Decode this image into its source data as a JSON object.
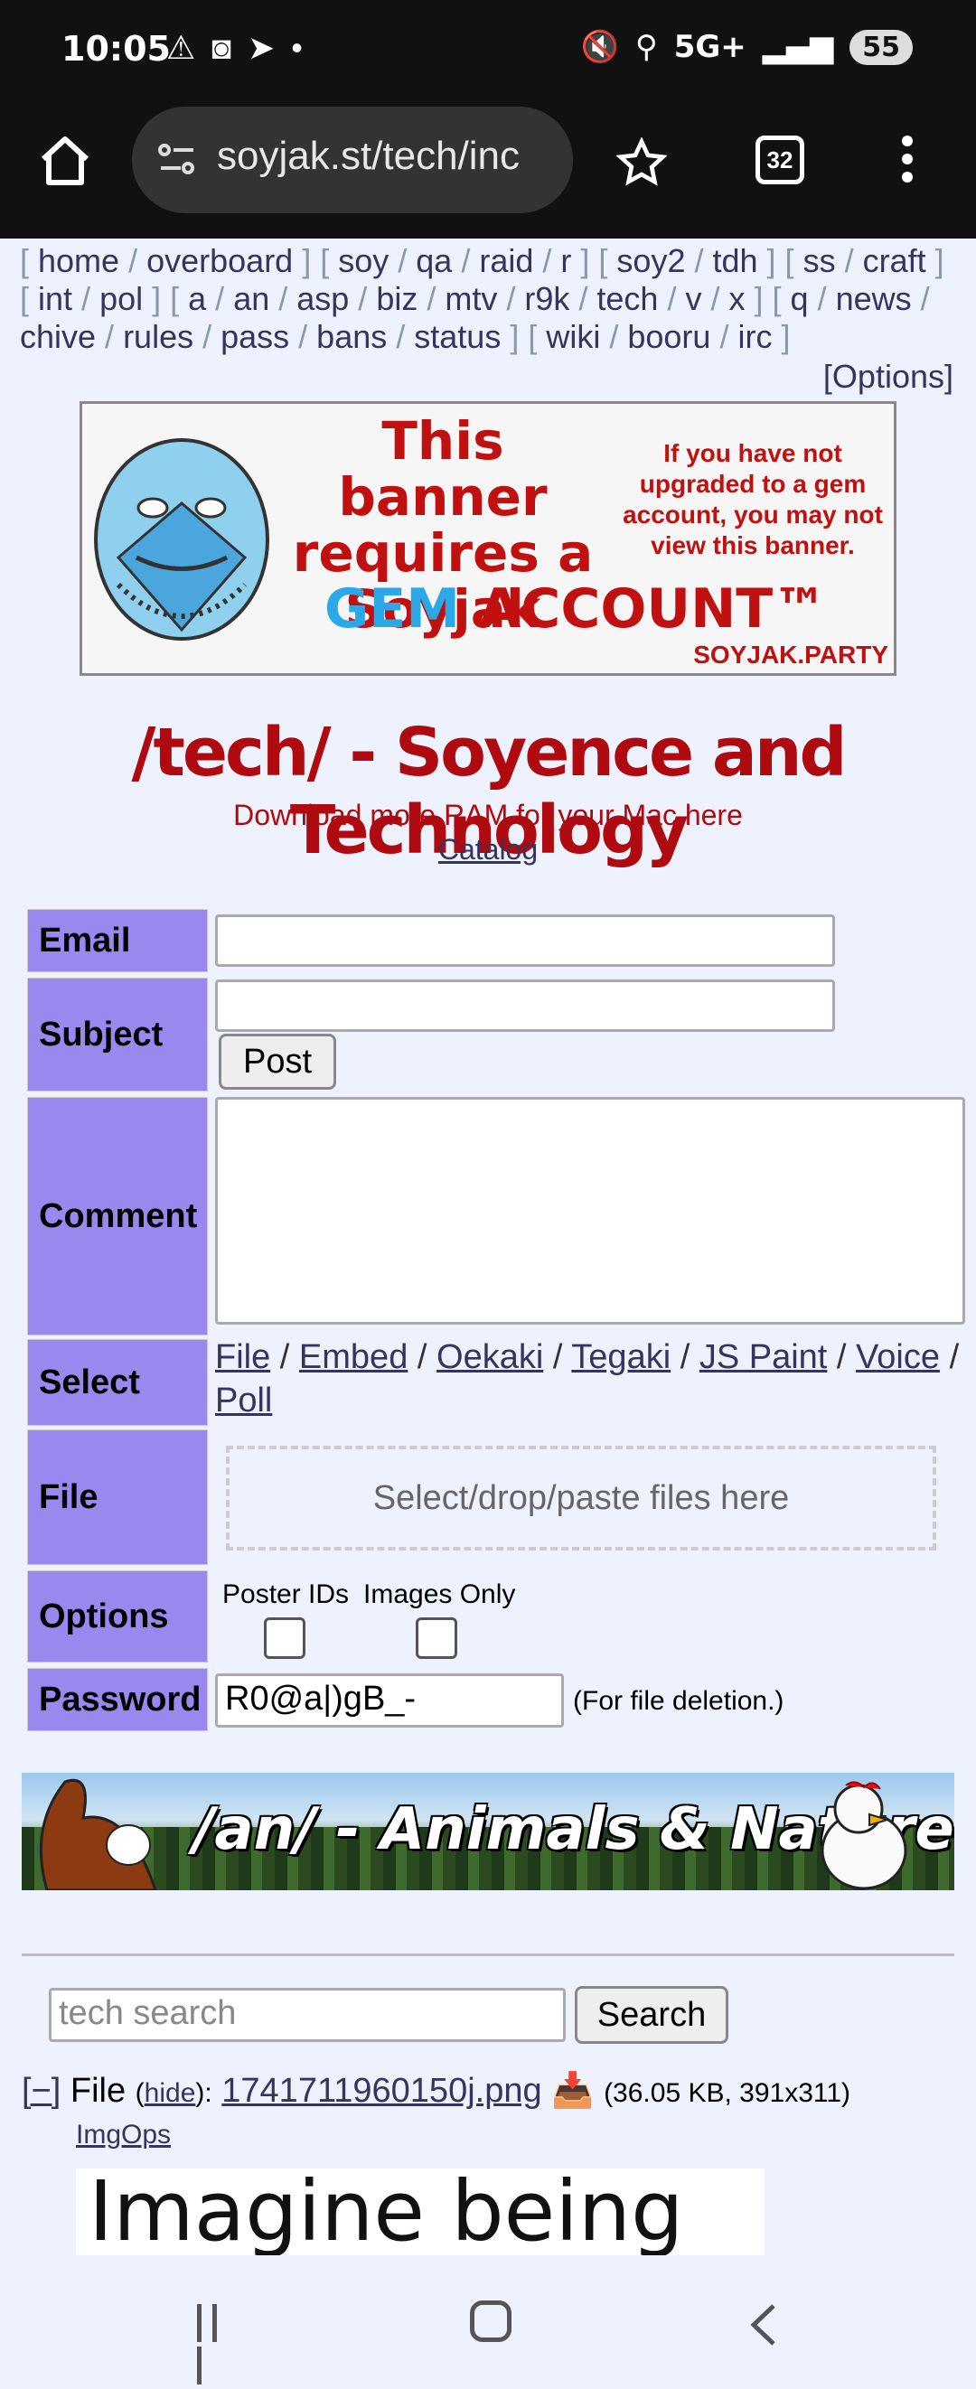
{
  "status_bar": {
    "time": "10:05",
    "network": "5G+",
    "battery": "55"
  },
  "browser": {
    "url": "soyjak.st/tech/inc",
    "tab_count": "32"
  },
  "board_nav": {
    "groups": [
      [
        "home",
        "overboard"
      ],
      [
        "soy",
        "qa",
        "raid",
        "r"
      ],
      [
        "soy2",
        "tdh"
      ],
      [
        "ss",
        "craft"
      ],
      [
        "int",
        "pol"
      ],
      [
        "a",
        "an",
        "asp",
        "biz",
        "mtv",
        "r9k",
        "tech",
        "v",
        "x"
      ],
      [
        "q",
        "news",
        "chive",
        "rules",
        "pass",
        "bans",
        "status"
      ],
      [
        "wiki",
        "booru",
        "irc"
      ]
    ],
    "options": "[Options]"
  },
  "banner": {
    "line1": "This banner",
    "line2": "requires a",
    "line3": "Soyjak",
    "gem": "GEM",
    "account": "ACCOUNT™",
    "small": "If you have not upgraded to a gem account, you may not view this banner.",
    "site": "SOYJAK.PARTY"
  },
  "board": {
    "title": "/tech/ - Soyence and Technology",
    "subtitle": "Download more RAM for your Mac here",
    "catalog": "Catalog"
  },
  "form": {
    "email_label": "Email",
    "subject_label": "Subject",
    "post_button": "Post",
    "comment_label": "Comment",
    "select_label": "Select",
    "select_links": [
      "File",
      "Embed",
      "Oekaki",
      "Tegaki",
      "JS Paint",
      "Voice",
      "Poll"
    ],
    "file_label": "File",
    "dropzone": "Select/drop/paste files here",
    "options_label": "Options",
    "poster_ids": "Poster IDs",
    "images_only": "Images Only",
    "password_label": "Password",
    "password_value": "R0@a|)gB_-",
    "password_note": "(For file deletion.)"
  },
  "an_banner": {
    "text": "/an/ - Animals & Nature"
  },
  "search": {
    "placeholder": "tech search",
    "button": "Search"
  },
  "post": {
    "collapse": "[−]",
    "file_word": "File",
    "hide": "hide",
    "filename": "1741711960150j.png",
    "meta": "(36.05 KB, 391x311)",
    "imgops": "ImgOps",
    "thumb_text": "Imagine being"
  },
  "colors": {
    "label_bg": "#9988ee",
    "title_red": "#af0a0f",
    "link": "#34345c",
    "page_bg": "#eef2ff"
  }
}
